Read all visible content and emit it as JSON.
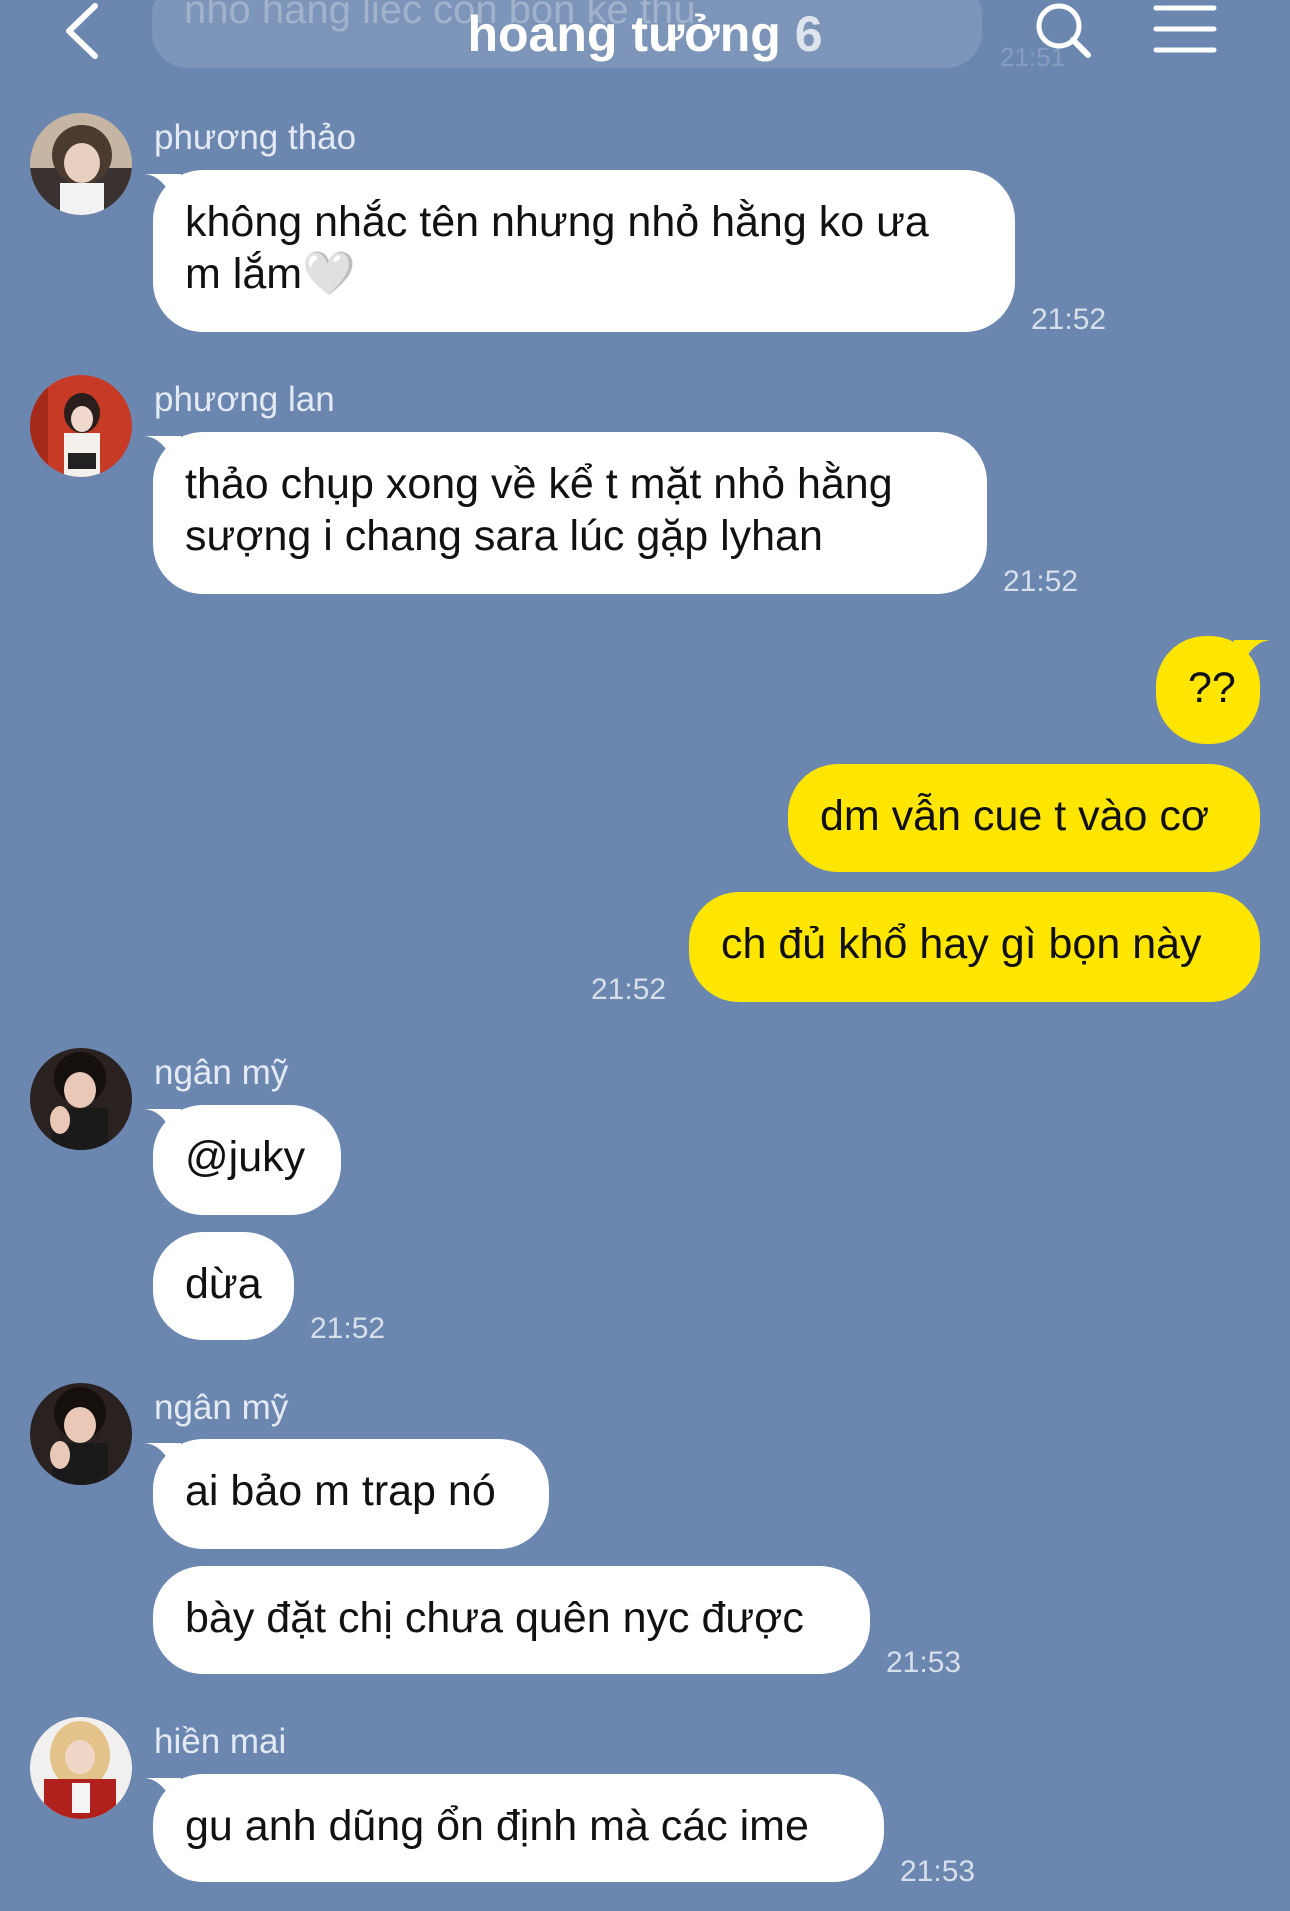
{
  "header": {
    "title": "hoang tưởng",
    "member_count": "6",
    "pinned_preview": "nhỏ hằng liếc còn bọn kẻ thù",
    "pinned_time": "21:51"
  },
  "messages": [
    {
      "sender": "phương thảo",
      "text_lines": [
        "không nhắc tên nhưng nhỏ hằng ko ưa",
        "m lắm🤍"
      ],
      "time": "21:52"
    },
    {
      "sender": "phương lan",
      "text_lines": [
        "thảo chụp xong về kể t mặt nhỏ hằng",
        "sượng i chang sara lúc gặp lyhan"
      ],
      "time": "21:52"
    },
    {
      "outgoing": [
        "??",
        "dm vẫn cue t vào cơ",
        "ch đủ khổ hay gì bọn này"
      ],
      "time": "21:52"
    },
    {
      "sender": "ngân mỹ",
      "texts": [
        "@juky",
        "dừa"
      ],
      "time": "21:52"
    },
    {
      "sender": "ngân mỹ",
      "texts": [
        "ai bảo m trap nó",
        "bày đặt chị chưa quên nyc được"
      ],
      "time": "21:53"
    },
    {
      "sender": "hiền mai",
      "texts": [
        "gu anh dũng ổn định mà các ime"
      ],
      "time": "21:53"
    }
  ],
  "colors": {
    "background": "#6b87b0",
    "incoming_bubble": "#ffffff",
    "outgoing_bubble": "#ffe600"
  }
}
